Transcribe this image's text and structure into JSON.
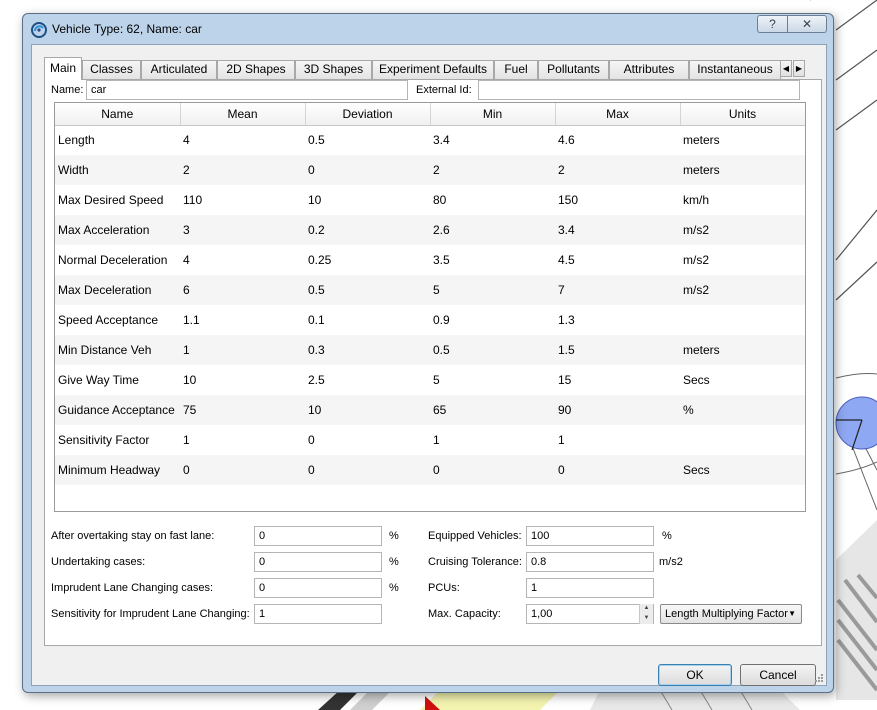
{
  "window": {
    "title": "Vehicle Type: 62, Name: car",
    "help_label": "?",
    "close_label": "✕"
  },
  "tabs": [
    {
      "label": "Main"
    },
    {
      "label": "Classes"
    },
    {
      "label": "Articulated"
    },
    {
      "label": "2D Shapes"
    },
    {
      "label": "3D Shapes"
    },
    {
      "label": "Experiment Defaults"
    },
    {
      "label": "Fuel"
    },
    {
      "label": "Pollutants"
    },
    {
      "label": "Attributes"
    },
    {
      "label": "Instantaneous"
    }
  ],
  "header": {
    "name_label": "Name:",
    "name_value": "car",
    "external_id_label": "External Id:",
    "external_id_value": ""
  },
  "table": {
    "columns": [
      "Name",
      "Mean",
      "Deviation",
      "Min",
      "Max",
      "Units"
    ],
    "rows": [
      [
        "Length",
        "4",
        "0.5",
        "3.4",
        "4.6",
        "meters"
      ],
      [
        "Width",
        "2",
        "0",
        "2",
        "2",
        "meters"
      ],
      [
        "Max Desired Speed",
        "110",
        "10",
        "80",
        "150",
        "km/h"
      ],
      [
        "Max Acceleration",
        "3",
        "0.2",
        "2.6",
        "3.4",
        "m/s2"
      ],
      [
        "Normal Deceleration",
        "4",
        "0.25",
        "3.5",
        "4.5",
        "m/s2"
      ],
      [
        "Max Deceleration",
        "6",
        "0.5",
        "5",
        "7",
        "m/s2"
      ],
      [
        "Speed Acceptance",
        "1.1",
        "0.1",
        "0.9",
        "1.3",
        ""
      ],
      [
        "Min Distance Veh",
        "1",
        "0.3",
        "0.5",
        "1.5",
        "meters"
      ],
      [
        "Give Way Time",
        "10",
        "2.5",
        "5",
        "15",
        "Secs"
      ],
      [
        "Guidance Acceptance",
        "75",
        "10",
        "65",
        "90",
        "%"
      ],
      [
        "Sensitivity Factor",
        "1",
        "0",
        "1",
        "1",
        ""
      ],
      [
        "Minimum Headway",
        "0",
        "0",
        "0",
        "0",
        "Secs"
      ]
    ]
  },
  "params": {
    "overtaking_label": "After overtaking stay on fast lane:",
    "overtaking_value": "0",
    "overtaking_unit": "%",
    "undertaking_label": "Undertaking cases:",
    "undertaking_value": "0",
    "undertaking_unit": "%",
    "imprudent_label": "Imprudent Lane Changing cases:",
    "imprudent_value": "0",
    "imprudent_unit": "%",
    "sensitivity_label": "Sensitivity for Imprudent Lane Changing:",
    "sensitivity_value": "1",
    "equipped_label": "Equipped Vehicles:",
    "equipped_value": "100",
    "equipped_unit": "%",
    "cruising_label": "Cruising Tolerance:",
    "cruising_value": "0.8",
    "cruising_unit": "m/s2",
    "pcus_label": "PCUs:",
    "pcus_value": "1",
    "capacity_label": "Max. Capacity:",
    "capacity_value": "1,00",
    "capacity_mode": "Length Multiplying Factor"
  },
  "buttons": {
    "ok": "OK",
    "cancel": "Cancel"
  },
  "colors": {
    "window_frame": "#bcd3ea",
    "client_bg": "#f0f0f0",
    "map_circle": "#8fa8f4"
  }
}
